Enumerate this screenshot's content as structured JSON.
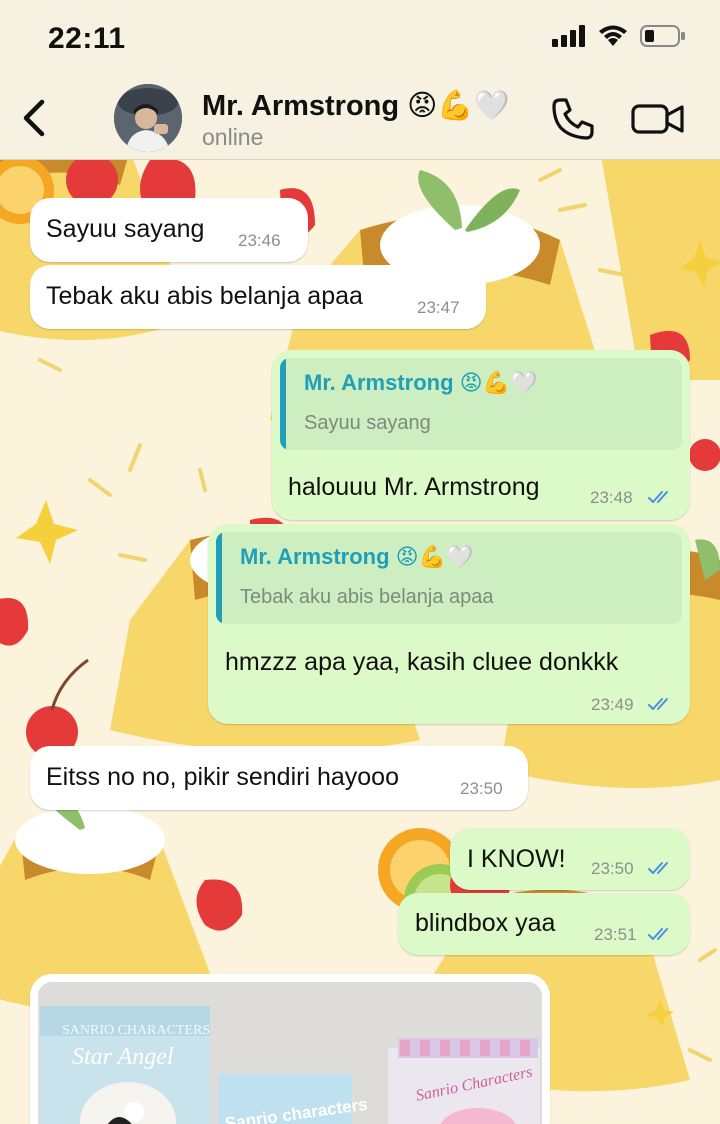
{
  "status_bar": {
    "time": "22:11"
  },
  "header": {
    "contact_name": "Mr. Armstrong 😡💪🤍",
    "contact_status": "online"
  },
  "messages": [
    {
      "direction": "incoming",
      "text": "Sayuu sayang",
      "time": "23:46"
    },
    {
      "direction": "incoming",
      "text": "Tebak aku abis belanja apaa",
      "time": "23:47"
    },
    {
      "direction": "outgoing",
      "quote_name": "Mr. Armstrong 😡💪🤍",
      "quote_text": "Sayuu sayang",
      "text": "halouuu Mr. Armstrong",
      "time": "23:48",
      "status": "read"
    },
    {
      "direction": "outgoing",
      "quote_name": "Mr. Armstrong 😡💪🤍",
      "quote_text": "Tebak aku abis belanja apaa",
      "text": "hmzzz apa yaa, kasih cluee donkkk",
      "time": "23:49",
      "status": "read"
    },
    {
      "direction": "incoming",
      "text": "Eitss no no, pikir sendiri hayooo",
      "time": "23:50"
    },
    {
      "direction": "outgoing",
      "text": "I KNOW!",
      "time": "23:50",
      "status": "read"
    },
    {
      "direction": "outgoing",
      "text": "blindbox yaa",
      "time": "23:51",
      "status": "read"
    },
    {
      "direction": "incoming",
      "type": "photo",
      "photo_text": [
        "SANRIO CHARACTERS",
        "Star Angel",
        "Sanrio characters",
        "Sanrio Characters"
      ]
    }
  ],
  "colors": {
    "incoming_bubble": "#ffffff",
    "outgoing_bubble": "#dcfac7",
    "quote_accent": "#1f9fb8",
    "read_ticks": "#4a8fe0",
    "header_bg": "#f7f1e1"
  },
  "icons": {
    "back": "chevron-left-icon",
    "call": "phone-icon",
    "video": "video-camera-icon",
    "signal": "signal-icon",
    "wifi": "wifi-icon",
    "battery": "battery-icon",
    "read_receipt": "double-check-icon"
  }
}
